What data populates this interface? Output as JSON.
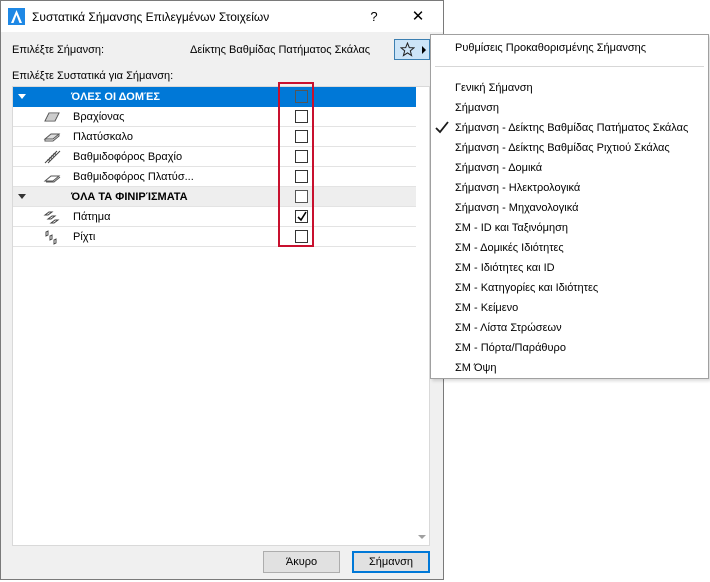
{
  "window": {
    "title": "Συστατικά Σήμανσης Επιλεγμένων Στοιχείων",
    "help_label": "?",
    "close_label": "✕"
  },
  "select_markup": {
    "label": "Επιλέξτε Σήμανση:",
    "current_value": "Δείκτης Βαθμίδας Πατήματος Σκάλας",
    "favorites_icon": "star-icon"
  },
  "components": {
    "label": "Επιλέξτε Συστατικά για Σήμανση:",
    "rows": [
      {
        "label": "ΌΛΕΣ ΟΙ ΔΟΜΈΣ",
        "type": "category",
        "selected": true,
        "checked": false
      },
      {
        "label": "Βραχίονας",
        "type": "item",
        "icon": "stair-flight-icon",
        "checked": false
      },
      {
        "label": "Πλατύσκαλο",
        "type": "item",
        "icon": "stair-landing-icon",
        "checked": false
      },
      {
        "label": "Βαθμιδοφόρος Βραχίο",
        "type": "item",
        "icon": "flight-stringer-icon",
        "checked": false
      },
      {
        "label": "Βαθμιδοφόρος Πλατύσ...",
        "type": "item",
        "icon": "landing-stringer-icon",
        "checked": false
      },
      {
        "label": "ΌΛΑ ΤΑ ΦΙΝΙΡΊΣΜΑΤΑ",
        "type": "category",
        "selected": false,
        "checked": false
      },
      {
        "label": "Πάτημα",
        "type": "item",
        "icon": "tread-icon",
        "checked": true
      },
      {
        "label": "Ρίχτι",
        "type": "item",
        "icon": "riser-icon",
        "checked": false
      }
    ]
  },
  "buttons": {
    "cancel": "Άκυρο",
    "ok": "Σήμανση"
  },
  "menu": {
    "header": "Ρυθμίσεις Προκαθορισμένης Σήμανσης",
    "items": [
      {
        "label": "Γενική Σήμανση",
        "checked": false
      },
      {
        "label": "Σήμανση",
        "checked": false
      },
      {
        "label": "Σήμανση - Δείκτης Βαθμίδας Πατήματος Σκάλας",
        "checked": true
      },
      {
        "label": "Σήμανση - Δείκτης Βαθμίδας Ριχτιού Σκάλας",
        "checked": false
      },
      {
        "label": "Σήμανση - Δομικά",
        "checked": false
      },
      {
        "label": "Σήμανση - Ηλεκτρολογικά",
        "checked": false
      },
      {
        "label": "Σήμανση - Μηχανολογικά",
        "checked": false
      },
      {
        "label": "ΣΜ - ID και Ταξινόμηση",
        "checked": false
      },
      {
        "label": "ΣΜ - Δομικές Ιδιότητες",
        "checked": false
      },
      {
        "label": "ΣΜ - Ιδιότητες και ID",
        "checked": false
      },
      {
        "label": "ΣΜ - Κατηγορίες και Ιδιότητες",
        "checked": false
      },
      {
        "label": "ΣΜ - Κείμενο",
        "checked": false
      },
      {
        "label": "ΣΜ - Λίστα Στρώσεων",
        "checked": false
      },
      {
        "label": "ΣΜ - Πόρτα/Παράθυρο",
        "checked": false
      },
      {
        "label": "ΣΜ Όψη",
        "checked": false
      }
    ]
  },
  "colors": {
    "selection": "#0078d7",
    "highlight_frame": "#c8102e",
    "favorites_button": "#cce4f7"
  }
}
